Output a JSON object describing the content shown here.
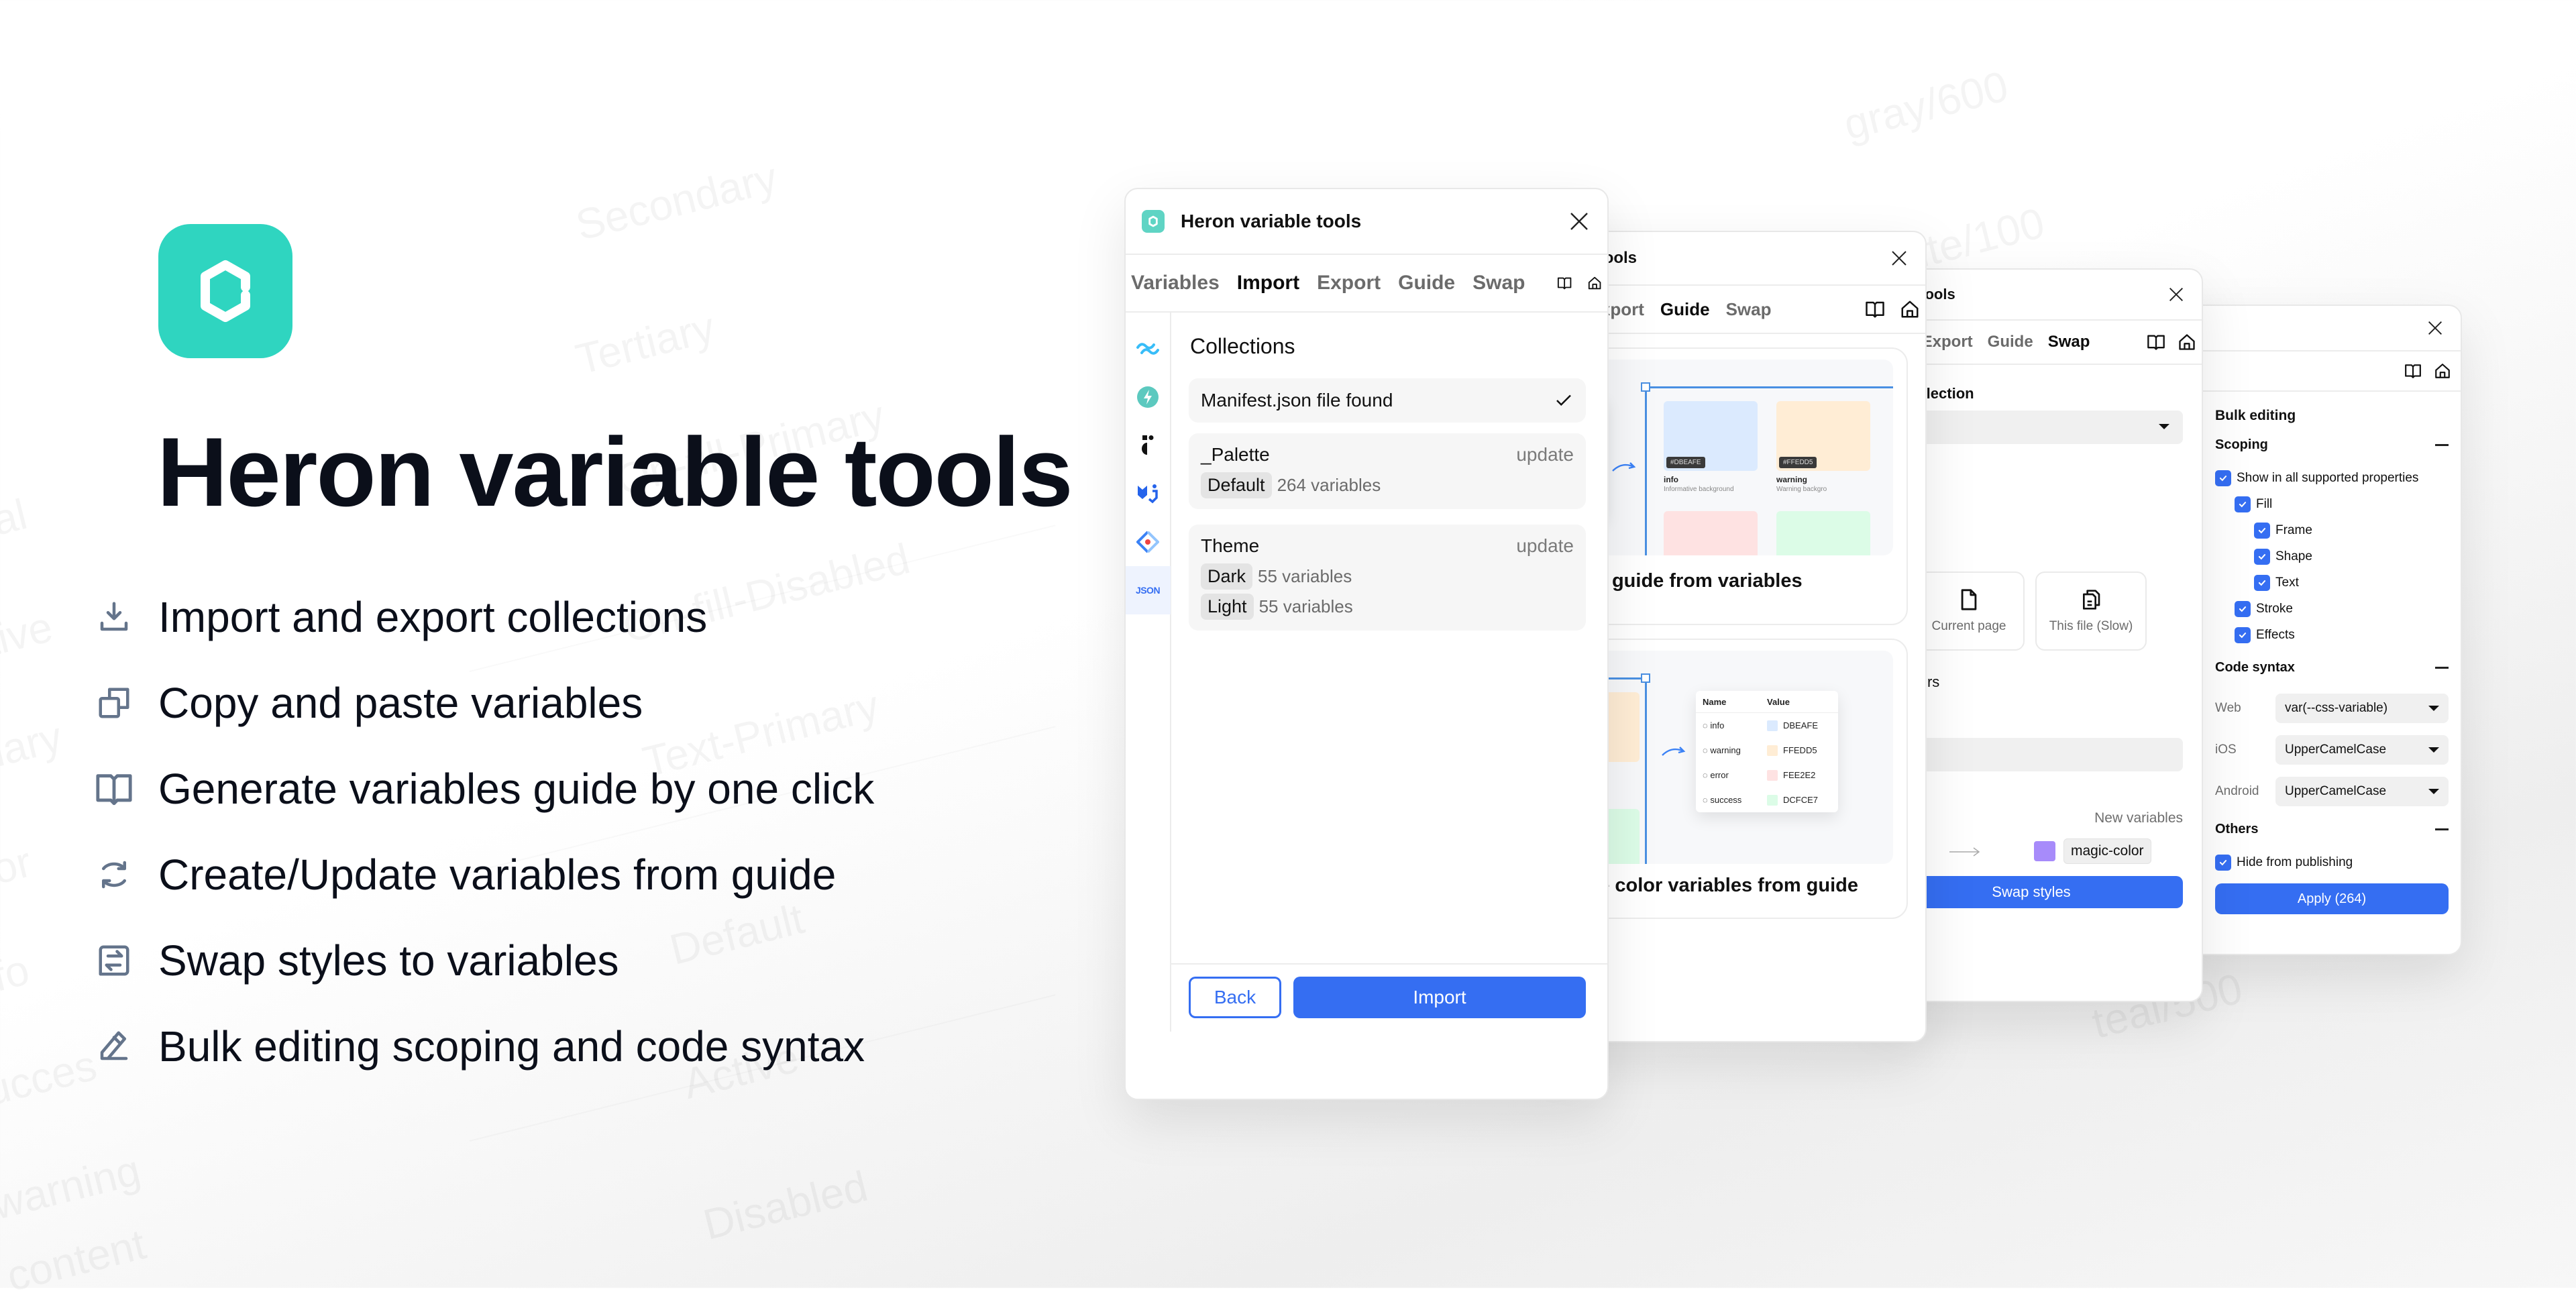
{
  "background_watermarks": [
    "Primary",
    "Secondary",
    "Tertiary",
    "On-fill-Primary",
    "On-fill-Disabled",
    "Text-Primary",
    "Default",
    "Active",
    "Disabled",
    "gray/600",
    "white/100",
    "teal/500",
    "al",
    "tive",
    "nary",
    "or",
    "fo",
    "ucces",
    "warning",
    "n content"
  ],
  "hero": {
    "title": "Heron variable tools",
    "brand_color": "#2FD5C0",
    "features": [
      {
        "icon": "download-icon",
        "text": "Import and export collections"
      },
      {
        "icon": "copy-icon",
        "text": "Copy and paste variables"
      },
      {
        "icon": "book-open-icon",
        "text": "Generate variables guide by one click"
      },
      {
        "icon": "refresh-icon",
        "text": "Create/Update variables from guide"
      },
      {
        "icon": "swap-icon",
        "text": "Swap styles to variables"
      },
      {
        "icon": "pencil-icon",
        "text": "Bulk editing scoping and code syntax"
      }
    ]
  },
  "plugin": {
    "title": "Heron variable tools",
    "title_partial_guide": "riable tools",
    "title_partial_swap": "able tools",
    "tabs": [
      "Variables",
      "Import",
      "Export",
      "Guide",
      "Swap"
    ],
    "tab_partial": "port",
    "accent_color": "#356EF2"
  },
  "import_window": {
    "active_tab": "Import",
    "rail": [
      {
        "icon": "tailwind-icon"
      },
      {
        "icon": "bolt-icon"
      },
      {
        "icon": "figma-tokens-icon"
      },
      {
        "icon": "mui-icon"
      },
      {
        "icon": "diamond-icon"
      },
      {
        "icon": "json-icon",
        "label": "JSON",
        "active": true
      }
    ],
    "heading": "Collections",
    "manifest": "Manifest.json file found",
    "collections": [
      {
        "name": "_Palette",
        "action": "update",
        "modes": [
          {
            "mode": "Default",
            "count": "264 variables"
          }
        ]
      },
      {
        "name": "Theme",
        "action": "update",
        "modes": [
          {
            "mode": "Dark",
            "count": "55 variables"
          },
          {
            "mode": "Light",
            "count": "55 variables"
          }
        ]
      }
    ],
    "back_label": "Back",
    "import_label": "Import"
  },
  "guide_window": {
    "active_tab": "Guide",
    "cards": [
      {
        "caption": "color guide from variables"
      },
      {
        "caption": "pdate color variables from guide"
      }
    ],
    "value_table": {
      "header": "Value",
      "values": [
        "DBEAFE",
        "FFEDD5",
        "FEE2E2",
        "DCFCE7"
      ]
    },
    "tiles": [
      {
        "tag": "#DBEAFE",
        "name": "info",
        "desc": "Informative background",
        "color": "#DBEAFE"
      },
      {
        "tag": "#FFEDD5",
        "name": "warning",
        "desc": "Warning backgro",
        "color": "#FFEDD5"
      },
      {
        "color": "#FEE2E2"
      },
      {
        "color": "#DCFCE7"
      }
    ],
    "tile_partial": {
      "tag": "FFEDD5",
      "name": "rning",
      "desc": "rning background"
    },
    "name_value_table": {
      "headers": [
        "Name",
        "Value"
      ],
      "rows": [
        {
          "name": "info",
          "value": "DBEAFE",
          "color": "#DBEAFE"
        },
        {
          "name": "warning",
          "value": "FFEDD5",
          "color": "#FFEDD5"
        },
        {
          "name": "error",
          "value": "FEE2E2",
          "color": "#FEE2E2"
        },
        {
          "name": "success",
          "value": "DCFCE7",
          "color": "#DCFCE7"
        }
      ]
    }
  },
  "swap_window": {
    "active_tab": "Swap",
    "collection_label": "ble collection",
    "scope_options": [
      {
        "label": "",
        "selected": true
      },
      {
        "label": "Current page",
        "icon": "file-icon"
      },
      {
        "label": "This file (Slow)",
        "icon": "files-icon"
      }
    ],
    "hidden_layers_label": "en layers",
    "partial_label": "x",
    "new_variables_label": "New variables",
    "old_style_partial": "or",
    "new_variable": {
      "name": "magic-color",
      "color": "#A78BFA"
    },
    "swap_label": "Swap styles"
  },
  "bulk_window": {
    "heading": "Bulk editing",
    "scoping": {
      "title": "Scoping",
      "items": [
        {
          "label": "Show in all supported properties",
          "checked": true,
          "level": 0
        },
        {
          "label": "Fill",
          "checked": true,
          "level": 1
        },
        {
          "label": "Frame",
          "checked": true,
          "level": 2
        },
        {
          "label": "Shape",
          "checked": true,
          "level": 2
        },
        {
          "label": "Text",
          "checked": true,
          "level": 2
        },
        {
          "label": "Stroke",
          "checked": true,
          "level": 1
        },
        {
          "label": "Effects",
          "checked": true,
          "level": 1
        }
      ]
    },
    "code_syntax": {
      "title": "Code syntax",
      "rows": [
        {
          "platform": "Web",
          "value": "var(--css-variable)"
        },
        {
          "platform": "iOS",
          "value": "UpperCamelCase"
        },
        {
          "platform": "Android",
          "value": "UpperCamelCase"
        }
      ]
    },
    "others": {
      "title": "Others",
      "items": [
        {
          "label": "Hide from publishing",
          "checked": true
        }
      ]
    },
    "apply_label": "Apply (264)"
  }
}
